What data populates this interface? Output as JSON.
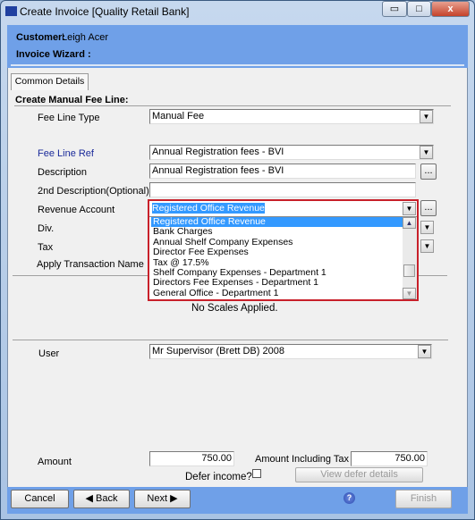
{
  "window": {
    "title": "Create Invoice [Quality Retail Bank]",
    "minimize": "▭",
    "maximize": "□",
    "close": "x"
  },
  "header": {
    "customer_label": "Customer:",
    "customer_value": "Leigh Acer",
    "wizard_label": "Invoice Wizard :"
  },
  "tabs": [
    {
      "label": "Common Details",
      "active": true
    }
  ],
  "section_title": "Create Manual Fee Line:",
  "form": {
    "fee_line_type": {
      "label": "Fee Line Type",
      "value": "Manual Fee"
    },
    "fee_line_ref": {
      "label": "Fee Line Ref",
      "value": "Annual Registration fees - BVI"
    },
    "description": {
      "label": "Description",
      "value": "Annual Registration fees - BVI"
    },
    "second_description": {
      "label": "2nd Description(Optional)",
      "value": ""
    },
    "revenue_account": {
      "label": "Revenue Account",
      "value": "Registered Office Revenue",
      "options": [
        "Registered Office Revenue",
        "Bank Charges",
        "Annual Shelf Company Expenses",
        "Director Fee Expenses",
        "Tax @ 17.5%",
        "Shelf Company Expenses - Department 1",
        "Directors Fee Expenses - Department 1",
        "General Office - Department 1"
      ]
    },
    "div": {
      "label": "Div."
    },
    "tax": {
      "label": "Tax"
    },
    "apply_transaction_name": {
      "label": "Apply Transaction Name"
    },
    "scales_text": "No Scales Applied.",
    "user": {
      "label": "User",
      "value": "Mr Supervisor (Brett DB) 2008"
    },
    "amount": {
      "label": "Amount",
      "value": "750.00"
    },
    "amount_incl_tax": {
      "label": "Amount Including Tax",
      "value": "750.00"
    },
    "defer_income": {
      "label": "Defer income?",
      "checked": false
    },
    "view_defer_details": "View defer details",
    "ellipsis": "..."
  },
  "footer": {
    "cancel": "Cancel",
    "back": "◀ Back",
    "next": "Next ▶",
    "help": "?",
    "finish": "Finish"
  },
  "colors": {
    "header_blue": "#6fa0e8",
    "highlight": "#3399ff",
    "dropdown_outline": "#c8202a"
  }
}
